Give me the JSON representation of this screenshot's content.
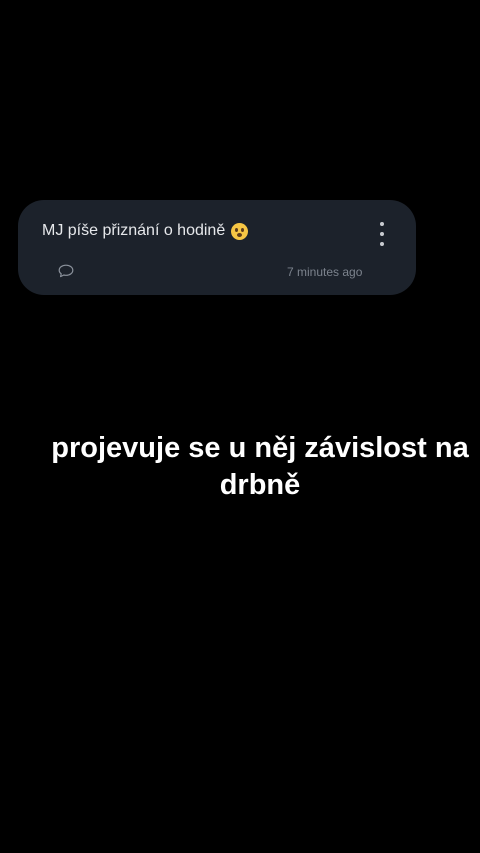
{
  "colors": {
    "background": "#000000",
    "card": "#1c222b",
    "card_text": "#e6e8eb",
    "muted_text": "#7c838d",
    "caption_text": "#ffffff"
  },
  "post_card": {
    "title": "MJ píše přiznání o hodině",
    "emoji": "flushed-face-emoji",
    "menu_icon": "more-vertical-icon",
    "comment_icon": "comment-icon",
    "timestamp": "7 minutes ago"
  },
  "caption": {
    "text": "projevuje se u něj závislost na drbně"
  }
}
